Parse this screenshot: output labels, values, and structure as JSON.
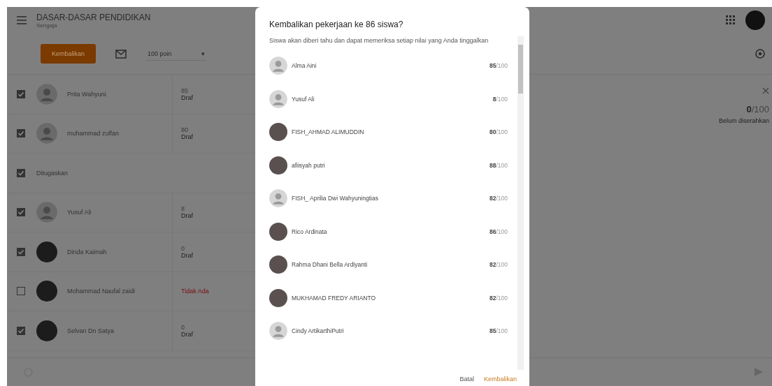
{
  "header": {
    "title": "DASAR-DASAR PENDIDIKAN",
    "subtitle": "Sengaja"
  },
  "toolbar": {
    "return_button": "Kembalikan",
    "points": "100 poin",
    "points_caret": "▾"
  },
  "rows": [
    {
      "kind": "student",
      "name": "Prita Wahyuni",
      "checked": true,
      "avatar": {
        "kind": "default"
      },
      "grade": "85",
      "status": "Draf"
    },
    {
      "kind": "student",
      "name": "muhammad zulfan",
      "checked": true,
      "avatar": {
        "kind": "default"
      },
      "grade": "80",
      "status": "Draf"
    },
    {
      "kind": "section",
      "name": "Ditugaskan",
      "checked": true
    },
    {
      "kind": "student",
      "name": "Yusuf Ali",
      "checked": true,
      "avatar": {
        "kind": "default"
      },
      "grade": "8",
      "status": "Draf"
    },
    {
      "kind": "student",
      "name": "Dinda Kaimah",
      "checked": true,
      "avatar": {
        "kind": "photo"
      },
      "grade": "0",
      "status": "Draf"
    },
    {
      "kind": "student",
      "name": "Mohammad Naufal zaidi",
      "checked": false,
      "avatar": {
        "kind": "photo"
      },
      "grade": "Tidak Ada"
    },
    {
      "kind": "student",
      "name": "Selvan Dn Satya",
      "checked": true,
      "avatar": {
        "kind": "photo"
      },
      "grade": "0",
      "status": "Draf"
    }
  ],
  "detail": {
    "score": "0",
    "total": "/100",
    "status": "Belum diserahkan"
  },
  "dialog": {
    "title": "Kembalikan pekerjaan ke 86 siswa?",
    "message": "Siswa akan diberi tahu dan dapat memeriksa setiap nilai yang Anda tinggalkan",
    "students": [
      {
        "name": "Alma Aini",
        "kind": "default",
        "score": "85",
        "total": "/100"
      },
      {
        "name": "Yusuf Ali",
        "kind": "default",
        "score": "8",
        "total": "/100"
      },
      {
        "name": "FISH_AHMAD ALIMUDDIN",
        "kind": "photo",
        "score": "80",
        "total": "/100"
      },
      {
        "name": "afiisyah putri",
        "kind": "photo",
        "score": "88",
        "total": "/100"
      },
      {
        "name": "FISH_ Aprilia Dwi Wahyuningtias",
        "kind": "default",
        "score": "82",
        "total": "/100"
      },
      {
        "name": "Rico Ardinata",
        "kind": "photo",
        "score": "86",
        "total": "/100"
      },
      {
        "name": "Rahma Dhani Bella Ardiyanti",
        "kind": "photo",
        "score": "82",
        "total": "/100"
      },
      {
        "name": "MUKHAMAD FREDY ARIANTO",
        "kind": "photo",
        "score": "82",
        "total": "/100"
      },
      {
        "name": "Cindy ArtikarthiPutri",
        "kind": "default",
        "score": "85",
        "total": "/100"
      }
    ],
    "cancel": "Batal",
    "confirm": "Kembalikan"
  }
}
